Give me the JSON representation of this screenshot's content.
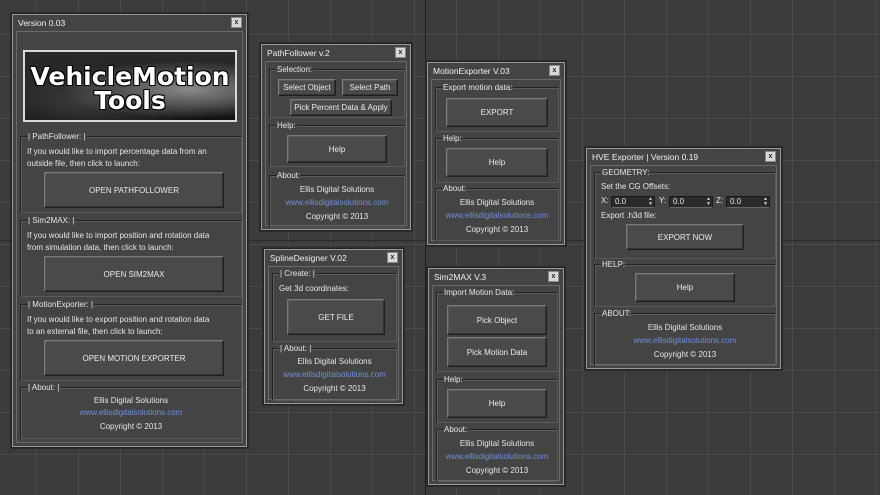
{
  "w1": {
    "title": "Version 0.03",
    "logo_line1": "VehicleMotion",
    "logo_line2": "Tools",
    "pathfollower": {
      "label": "| PathFollower: |",
      "line1": "If you would like to import percentage data from an",
      "line2": "outside file, then click to launch:",
      "button": "OPEN PATHFOLLOWER"
    },
    "sim2max": {
      "label": "| Sim2MAX: |",
      "line1": "If you would like to import position and rotation data",
      "line2": "from simulation data, then click to launch:",
      "button": "OPEN SIM2MAX"
    },
    "motionexporter": {
      "label": "| MotionExporter: |",
      "line1": "If you would like to export position and rotation data",
      "line2": "to an external file, then click to launch:",
      "button": "OPEN MOTION EXPORTER"
    },
    "about": {
      "label": "| About: |",
      "company": "Ellis Digital Solutions",
      "url": "www.ellisdigitalsolutions.com",
      "copyright": "Copyright © 2013"
    }
  },
  "w2": {
    "title": "PathFollower v.2",
    "selection_label": "Selection:",
    "select_object": "Select Object",
    "select_path": "Select Path",
    "pick_percent": "Pick Percent Data & Apply",
    "help_label": "Help:",
    "help_button": "Help",
    "about_label": "About:",
    "company": "Ellis Digital Solutions",
    "url": "www.ellisdigitalsolutions.com",
    "copyright": "Copyright © 2013"
  },
  "w3": {
    "title": "SplineDesigner V.02",
    "create_label": "| Create: |",
    "create_text": "Get 3d coordinates:",
    "get_file": "GET FILE",
    "about_label": "| About: |",
    "company": "Ellis Digital Solutions",
    "url": "www.ellisdigitalsolutions.com",
    "copyright": "Copyright © 2013"
  },
  "w4": {
    "title": "MotionExporter V.03",
    "export_label": "Export motion data:",
    "export_button": "EXPORT",
    "help_label": "Help:",
    "help_button": "Help",
    "about_label": "About:",
    "company": "Ellis Digital Solutions",
    "url": "www.ellisdigitalsolutions.com",
    "copyright": "Copyright © 2013"
  },
  "w5": {
    "title": "Sim2MAX V.3",
    "import_label": "Import Motion Data:",
    "pick_object": "Pick Object",
    "pick_motion": "Pick Motion Data",
    "help_label": "Help:",
    "help_button": "Help",
    "about_label": "About:",
    "company": "Ellis Digital Solutions",
    "url": "www.ellisdigitalsolutions.com",
    "copyright": "Copyright © 2013"
  },
  "w6": {
    "title": "HVE Exporter | Version 0.19",
    "geometry_label": "GEOMETRY:",
    "cg_text": "Set the CG Offsets:",
    "x_label": "X:",
    "x_value": "0.0",
    "y_label": "Y:",
    "y_value": "0.0",
    "z_label": "Z:",
    "z_value": "0.0",
    "export_text": "Export .h3d file:",
    "export_button": "EXPORT NOW",
    "help_label": "HELP:",
    "help_button": "Help",
    "about_label": "ABOUT:",
    "company": "Ellis Digital Solutions",
    "url": "www.ellisdigitalsolutions.com",
    "copyright": "Copyright © 2013"
  },
  "close_glyph": "x"
}
